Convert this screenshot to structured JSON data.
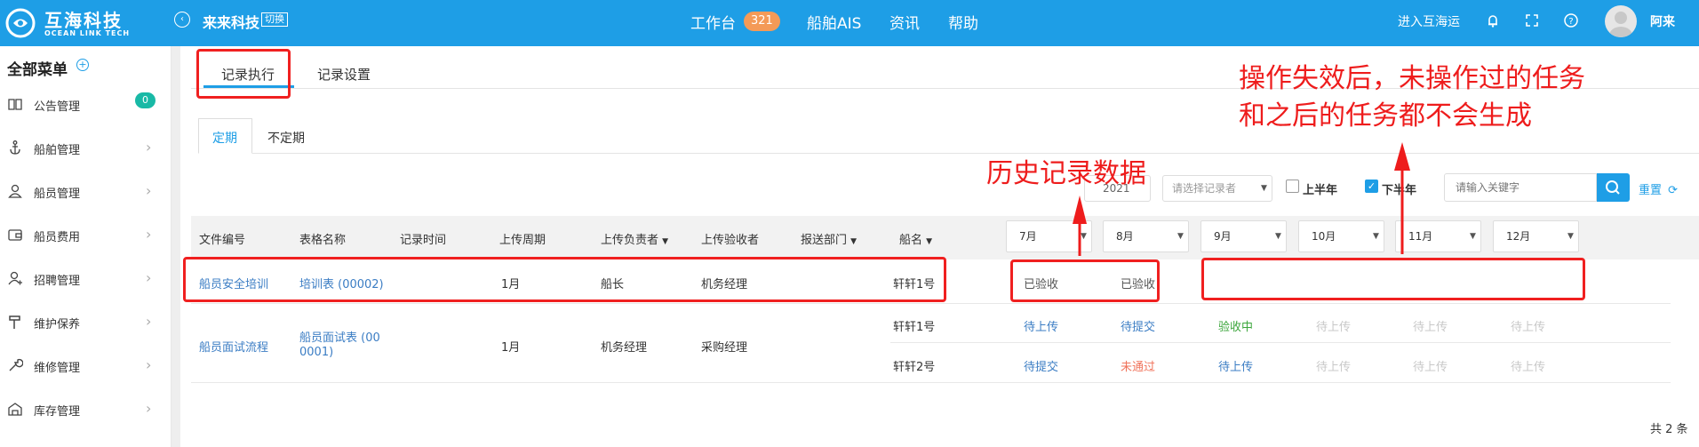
{
  "header": {
    "logo_cn": "互海科技",
    "logo_en": "OCEAN LINK TECH",
    "company": "来来科技",
    "switch_label": "切换",
    "nav": [
      {
        "label": "工作台",
        "badge": "321"
      },
      {
        "label": "船舶AIS"
      },
      {
        "label": "资讯"
      },
      {
        "label": "帮助"
      }
    ],
    "enter_link": "进入互海运",
    "username": "阿来"
  },
  "sidebar": {
    "title": "全部菜单",
    "items": [
      {
        "label": "公告管理",
        "icon": "book-icon",
        "badge": "0"
      },
      {
        "label": "船舶管理",
        "icon": "anchor-icon"
      },
      {
        "label": "船员管理",
        "icon": "user-icon"
      },
      {
        "label": "船员费用",
        "icon": "wallet-icon"
      },
      {
        "label": "招聘管理",
        "icon": "recruit-icon"
      },
      {
        "label": "维护保养",
        "icon": "hammer-icon"
      },
      {
        "label": "维修管理",
        "icon": "wrench-icon"
      },
      {
        "label": "库存管理",
        "icon": "warehouse-icon"
      }
    ]
  },
  "tabs": [
    "记录执行",
    "记录设置"
  ],
  "subtabs": [
    "定期",
    "不定期"
  ],
  "filters": {
    "year": "2021",
    "recorder_placeholder": "请选择记录者",
    "first_half": "上半年",
    "second_half": "下半年",
    "search_placeholder": "请输入关键字",
    "reset": "重置"
  },
  "table": {
    "columns": [
      "文件编号",
      "表格名称",
      "记录时间",
      "上传周期",
      "上传负责者",
      "上传验收者",
      "报送部门",
      "船名"
    ],
    "months": [
      "7月",
      "8月",
      "9月",
      "10月",
      "11月",
      "12月"
    ],
    "rows": [
      {
        "file_no": "船员安全培训",
        "form_name": "培训表 (00002)",
        "period": "1月",
        "uploader": "船长",
        "acceptor": "机务经理",
        "ships": [
          {
            "name": "轩轩1号",
            "statuses": [
              "已验收",
              "已验收",
              "",
              "",
              "",
              ""
            ]
          }
        ]
      },
      {
        "file_no": "船员面试流程",
        "form_name_l1": "船员面试表 (00",
        "form_name_l2": "0001)",
        "period": "1月",
        "uploader": "机务经理",
        "acceptor": "采购经理",
        "ships": [
          {
            "name": "轩轩1号",
            "statuses": [
              "待上传",
              "待提交",
              "验收中",
              "待上传",
              "待上传",
              "待上传"
            ]
          },
          {
            "name": "轩轩2号",
            "statuses": [
              "待提交",
              "未通过",
              "待上传",
              "待上传",
              "待上传",
              "待上传"
            ]
          }
        ]
      }
    ],
    "total": "共 2 条"
  },
  "annotations": {
    "history": "历史记录数据",
    "note_line1": "操作失效后，未操作过的任务",
    "note_line2": "和之后的任务都不会生成"
  },
  "colors": {
    "brand": "#1e9ee6",
    "annotation": "#ee1c1c",
    "pending": "#c8c8c8",
    "in_review": "#3ca63c",
    "rejected": "#f0735b"
  }
}
